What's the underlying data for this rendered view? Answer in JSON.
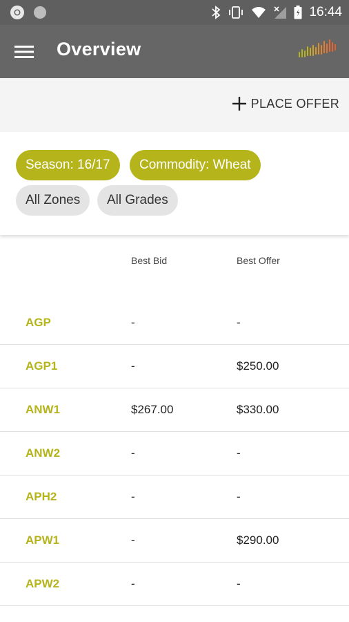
{
  "status_bar": {
    "time": "16:44"
  },
  "app_bar": {
    "title": "Overview"
  },
  "actions": {
    "place_offer_label": "PLACE OFFER"
  },
  "filters": [
    {
      "label": "Season: 16/17",
      "active": true
    },
    {
      "label": "Commodity: Wheat",
      "active": true
    },
    {
      "label": "All Zones",
      "active": false
    },
    {
      "label": "All Grades",
      "active": false
    }
  ],
  "table": {
    "headers": {
      "bid": "Best Bid",
      "offer": "Best Offer"
    },
    "rows": [
      {
        "grade": "AGP",
        "bid": "-",
        "offer": "-"
      },
      {
        "grade": "AGP1",
        "bid": "-",
        "offer": "$250.00"
      },
      {
        "grade": "ANW1",
        "bid": "$267.00",
        "offer": "$330.00"
      },
      {
        "grade": "ANW2",
        "bid": "-",
        "offer": "-"
      },
      {
        "grade": "APH2",
        "bid": "-",
        "offer": "-"
      },
      {
        "grade": "APW1",
        "bid": "-",
        "offer": "$290.00"
      },
      {
        "grade": "APW2",
        "bid": "-",
        "offer": "-"
      }
    ]
  },
  "colors": {
    "accent": "#b5b41b",
    "app_bar": "#666666",
    "status_bar": "#5f5f5f"
  }
}
